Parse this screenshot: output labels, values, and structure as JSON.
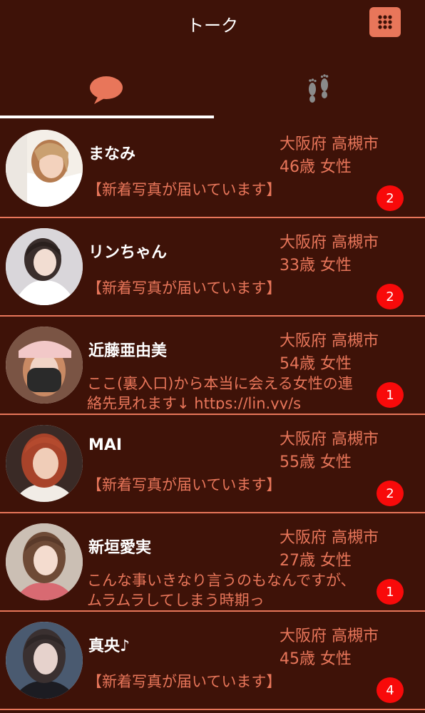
{
  "header": {
    "title": "トーク"
  },
  "icons": {
    "menu": "grid-menu-icon",
    "chat_tab": "chat-bubble-icon",
    "footprint_tab": "footprints-icon"
  },
  "colors": {
    "background": "#3e1208",
    "accent": "#e8765a",
    "badge": "#f80a0a",
    "text": "#ffffff"
  },
  "conversations": [
    {
      "name": "まなみ",
      "location": "大阪府 高槻市",
      "age_gender": "46歳 女性",
      "message": "【新着写真が届いています】",
      "unread": "2"
    },
    {
      "name": "リンちゃん",
      "location": "大阪府 高槻市",
      "age_gender": "33歳 女性",
      "message": "【新着写真が届いています】",
      "unread": "2"
    },
    {
      "name": "近藤亜由美",
      "location": "大阪府 高槻市",
      "age_gender": "54歳 女性",
      "message": "ここ(裏入口)から本当に会える女性の連絡先見れます↓ https://lin.yy/s",
      "unread": "1"
    },
    {
      "name": "MAI",
      "location": "大阪府 高槻市",
      "age_gender": "55歳 女性",
      "message": "【新着写真が届いています】",
      "unread": "2"
    },
    {
      "name": "新垣愛実",
      "location": "大阪府 高槻市",
      "age_gender": "27歳 女性",
      "message": "こんな事いきなり言うのもなんですが、ムラムラしてしまう時期っ",
      "unread": "1"
    },
    {
      "name": "真央♪",
      "location": "大阪府 高槻市",
      "age_gender": "45歳 女性",
      "message": "【新着写真が届いています】",
      "unread": "4"
    }
  ]
}
